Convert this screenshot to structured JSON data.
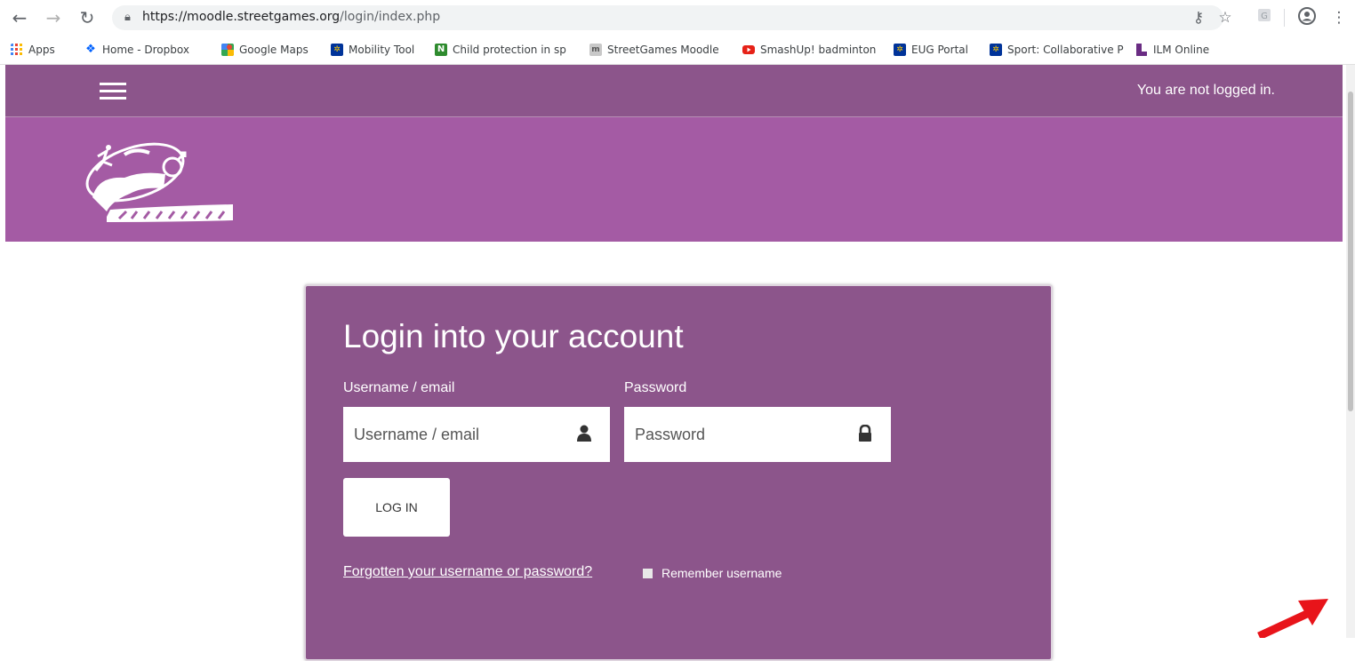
{
  "browser": {
    "url_host": "https://moodle.streetgames.org",
    "url_path": "/login/index.php",
    "bookmarks": [
      {
        "label": "Apps",
        "icon": "apps-grid-icon",
        "color": "#4285f4"
      },
      {
        "label": "Home - Dropbox",
        "icon": "dropbox-icon",
        "color": "#0061fe"
      },
      {
        "label": "Google Maps",
        "icon": "google-maps-icon",
        "color": "#34a853"
      },
      {
        "label": "Mobility Tool",
        "icon": "eu-flag-icon",
        "color": "#003399"
      },
      {
        "label": "Child protection in sp",
        "icon": "n-icon",
        "color": "#2e8b2e"
      },
      {
        "label": "StreetGames Moodle",
        "icon": "moodle-icon",
        "color": "#8a8a8a"
      },
      {
        "label": "SmashUp! badminton",
        "icon": "youtube-icon",
        "color": "#e62117"
      },
      {
        "label": "EUG Portal",
        "icon": "eu-flag-icon",
        "color": "#003399"
      },
      {
        "label": "Sport: Collaborative P",
        "icon": "eu-flag-icon",
        "color": "#003399"
      },
      {
        "label": "ILM Online",
        "icon": "ilm-icon",
        "color": "#6a2c83"
      }
    ]
  },
  "header": {
    "login_status": "You are not logged in."
  },
  "login": {
    "title": "Login into your account",
    "username_label": "Username / email",
    "username_placeholder": "Username / email",
    "password_label": "Password",
    "password_placeholder": "Password",
    "submit_label": "LOG IN",
    "forgot_link": "Forgotten your username or password?",
    "remember_label": "Remember username"
  },
  "colors": {
    "nav_purple": "#8c558b",
    "banner_purple": "#a45ba4",
    "annotation_red": "#e8141a"
  }
}
